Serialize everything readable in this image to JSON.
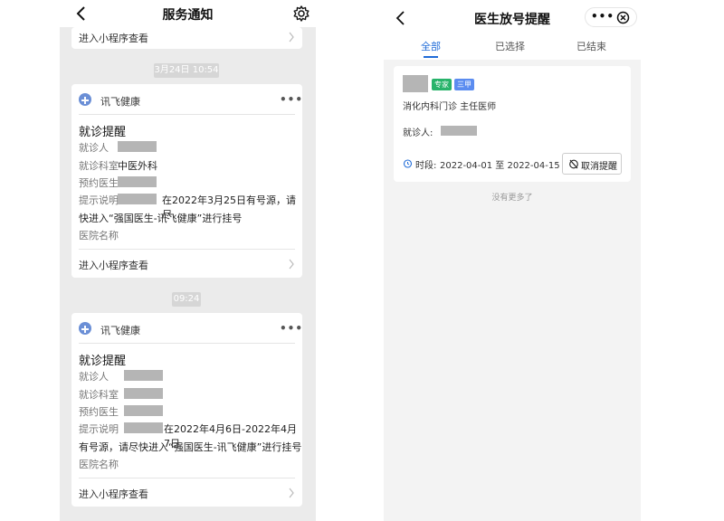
{
  "left": {
    "header": {
      "title": "服务通知"
    },
    "top_card": {
      "link_label": "进入小程序查看"
    },
    "cards": [
      {
        "timestamp": "3月24日 10:54",
        "app_name": "讯飞健康",
        "title": "就诊提醒",
        "fields": {
          "patient_label": "就诊人",
          "dept_label": "就诊科室",
          "dept_value": "中医外科",
          "doctor_label": "预约医生",
          "note_label": "提示说明",
          "note_line1": "在2022年3月25日有号源，请尽",
          "note_line2": "快进入“强国医生-讯飞健康”进行挂号",
          "hospital_label": "医院名称"
        },
        "link_label": "进入小程序查看"
      },
      {
        "timestamp": "09:24",
        "app_name": "讯飞健康",
        "title": "就诊提醒",
        "fields": {
          "patient_label": "就诊人",
          "dept_label": "就诊科室",
          "doctor_label": "预约医生",
          "note_label": "提示说明",
          "note_line1": "在2022年4月6日-2022年4月7日",
          "note_line2": "有号源，请尽快进入“强国医生-讯飞健康”进行挂号",
          "hospital_label": "医院名称"
        },
        "link_label": "进入小程序查看"
      }
    ]
  },
  "right": {
    "header": {
      "title": "医生放号提醒"
    },
    "tabs": [
      {
        "label": "全部",
        "active": true
      },
      {
        "label": "已选择",
        "active": false
      },
      {
        "label": "已结束",
        "active": false
      }
    ],
    "card": {
      "tags": [
        {
          "label": "专家",
          "color": "#27b36a"
        },
        {
          "label": "三甲",
          "color": "#5b8cf0"
        }
      ],
      "dept": "消化内科门诊 主任医师",
      "patient_label": "就诊人:",
      "period_label": "时段:",
      "period_value": "2022-04-01 至 2022-04-15",
      "cancel_label": "取消提醒"
    },
    "no_more": "没有更多了"
  },
  "colors": {
    "accent": "#1f6bd8",
    "app_icon": "#6b8fd6",
    "redaction": "#b5b5b5"
  }
}
